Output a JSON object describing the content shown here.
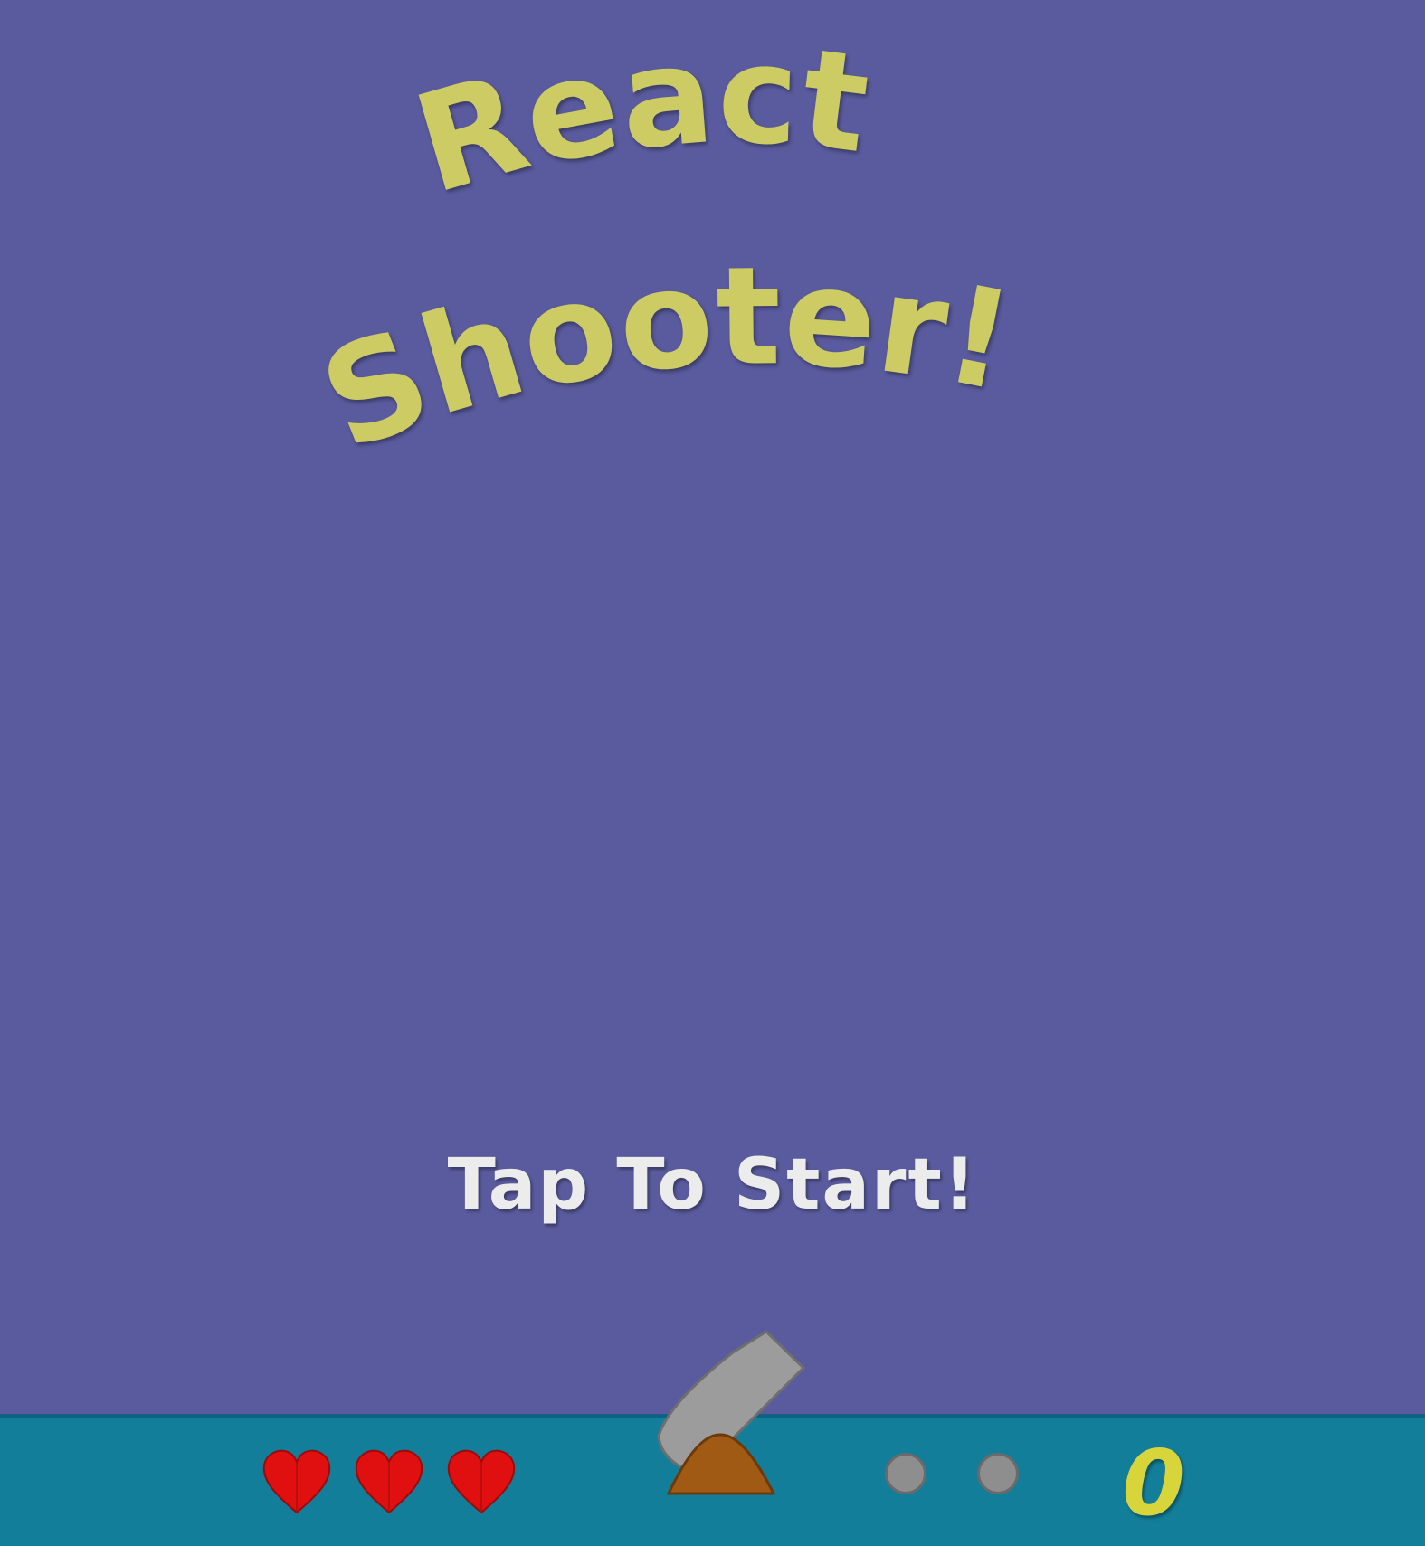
{
  "title": {
    "line1": "React",
    "line2": "Shooter!"
  },
  "start_prompt": "Tap To Start!",
  "hud": {
    "lives": 3,
    "ammo_slots": 2,
    "score": "0"
  },
  "icons": {
    "life": "heart-icon",
    "ammo": "cannonball-icon",
    "player": "cannon-icon"
  },
  "colors": {
    "sky": "#5a5b9e",
    "ground": "#137e9a",
    "title": "#cccb64",
    "start_text": "#ececec",
    "heart": "#e01010",
    "cannon_barrel": "#9a9a9a",
    "cannon_base": "#a05a14",
    "score": "#d8d53a"
  }
}
